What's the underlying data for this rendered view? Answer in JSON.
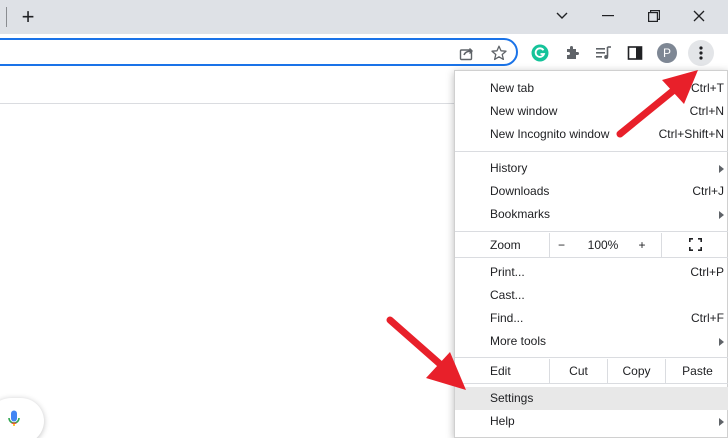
{
  "tabstrip": {
    "new_tab_symbol": "+"
  },
  "toolbar": {
    "profile_initial": "P"
  },
  "menu": {
    "group1": [
      {
        "label": "New tab",
        "shortcut": "Ctrl+T"
      },
      {
        "label": "New window",
        "shortcut": "Ctrl+N"
      },
      {
        "label": "New Incognito window",
        "shortcut": "Ctrl+Shift+N"
      }
    ],
    "group2": [
      {
        "label": "History",
        "submenu": true
      },
      {
        "label": "Downloads",
        "shortcut": "Ctrl+J"
      },
      {
        "label": "Bookmarks",
        "submenu": true
      }
    ],
    "zoom": {
      "label": "Zoom",
      "minus": "−",
      "level": "100%",
      "plus": "+"
    },
    "group3": [
      {
        "label": "Print...",
        "shortcut": "Ctrl+P"
      },
      {
        "label": "Cast..."
      },
      {
        "label": "Find...",
        "shortcut": "Ctrl+F"
      },
      {
        "label": "More tools",
        "submenu": true
      }
    ],
    "edit": {
      "label": "Edit",
      "cut": "Cut",
      "copy": "Copy",
      "paste": "Paste"
    },
    "group4": [
      {
        "label": "Settings"
      },
      {
        "label": "Help",
        "submenu": true
      }
    ]
  },
  "colors": {
    "accent": "#1a73e8",
    "annotation_red": "#e8202a",
    "grammarly_green": "#15c39a",
    "highlight": "#e8e8e8"
  },
  "icons": [
    "close-icon",
    "maximize-icon",
    "minimize-icon",
    "share-icon",
    "star-icon",
    "grammarly-icon",
    "extensions-icon",
    "media-queue-icon",
    "side-panel-icon",
    "kebab-menu-icon",
    "fullscreen-icon",
    "mic-icon"
  ]
}
